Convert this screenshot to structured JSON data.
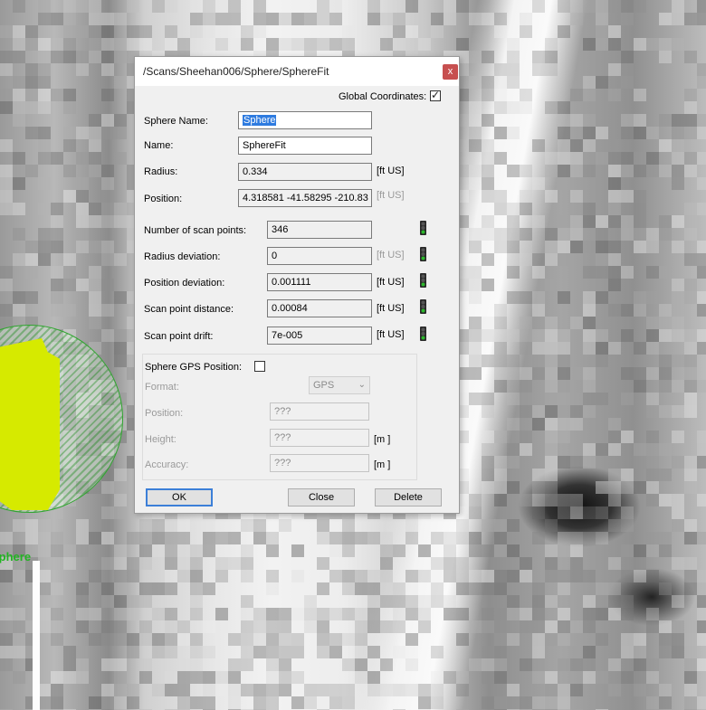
{
  "viewport": {
    "sphere_label": "Sphere"
  },
  "dialog": {
    "title": "/Scans/Sheehan006/Sphere/SphereFit",
    "close_glyph": "x",
    "global_coordinates": {
      "label": "Global Coordinates:",
      "checked": true,
      "check_glyph": "✓"
    },
    "sphere_name": {
      "label": "Sphere Name:",
      "value": "Sphere"
    },
    "name": {
      "label": "Name:",
      "value": "SphereFit"
    },
    "radius": {
      "label": "Radius:",
      "value": "0.334",
      "unit": "[ft US]"
    },
    "position": {
      "label": "Position:",
      "value": "4.318581 -41.58295 -210.83",
      "unit": "[ft US]"
    },
    "stats": [
      {
        "label": "Number of scan points:",
        "value": "346",
        "unit": "",
        "status": "green"
      },
      {
        "label": "Radius deviation:",
        "value": "0",
        "unit": "[ft US]",
        "status": "green"
      },
      {
        "label": "Position deviation:",
        "value": "0.001111",
        "unit": "[ft US]",
        "status": "green"
      },
      {
        "label": "Scan point distance:",
        "value": "0.00084",
        "unit": "[ft US]",
        "status": "green"
      },
      {
        "label": "Scan point drift:",
        "value": "7e-005",
        "unit": "[ft US]",
        "status": "green"
      }
    ],
    "gps": {
      "label": "Sphere GPS Position:",
      "checked": false,
      "format_label": "Format:",
      "format_value": "GPS",
      "position_label": "Position:",
      "position_value": "???",
      "height_label": "Height:",
      "height_value": "???",
      "height_unit": "[m  ]",
      "accuracy_label": "Accuracy:",
      "accuracy_value": "???",
      "accuracy_unit": "[m  ]"
    },
    "buttons": {
      "ok": "OK",
      "close": "Close",
      "delete": "Delete"
    }
  },
  "colors": {
    "traffic_light_green": "#2db82d",
    "sphere_label": "#22b422",
    "selection": "#2e7be0"
  }
}
